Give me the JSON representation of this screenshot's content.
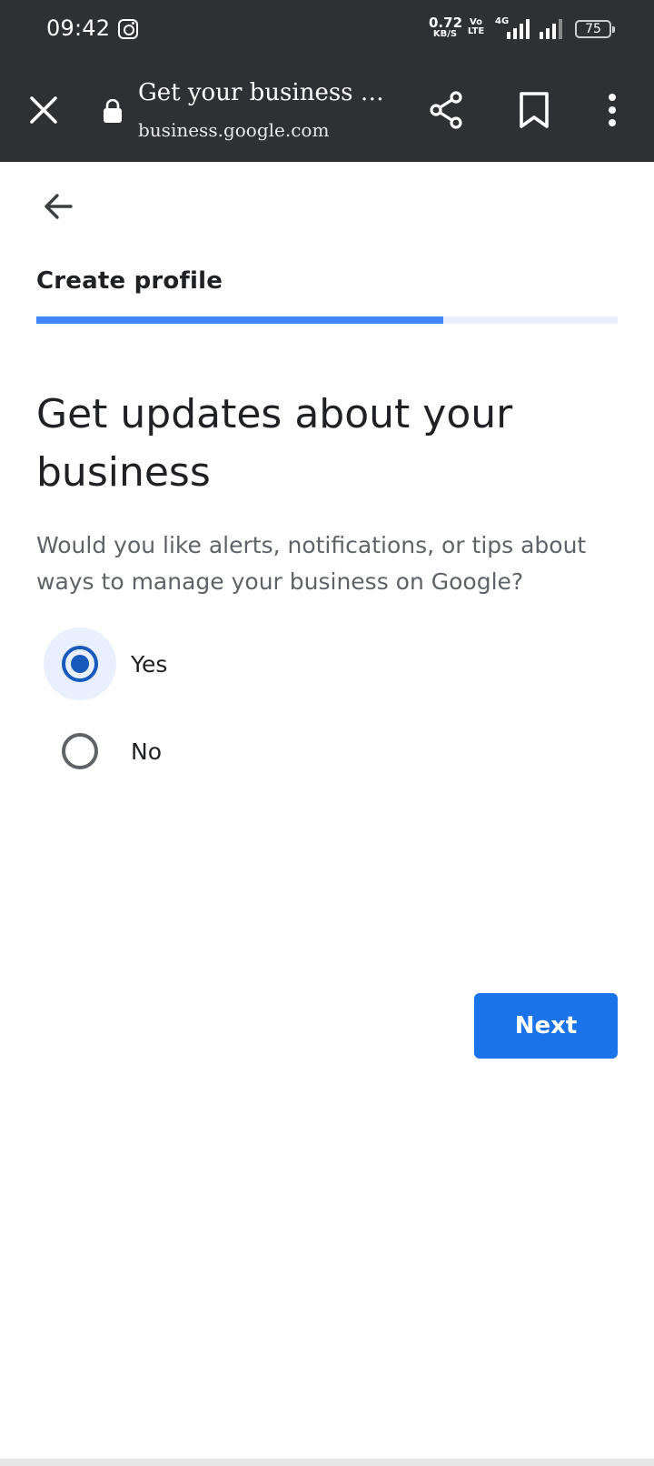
{
  "status_bar": {
    "time": "09:42",
    "speed_value": "0.72",
    "speed_unit": "KB/S",
    "volte_top": "Vo",
    "volte_bottom": "LTE",
    "network": "4G",
    "battery": "75"
  },
  "browser": {
    "page_title": "Get your business …",
    "url": "business.google.com"
  },
  "page": {
    "step_title": "Create profile",
    "progress_fraction": 0.7,
    "heading": "Get updates about your business",
    "description": "Would you like alerts, notifications, or tips about ways to manage your business on Google?",
    "options": [
      {
        "label": "Yes",
        "selected": true
      },
      {
        "label": "No",
        "selected": false
      }
    ],
    "next_label": "Next"
  },
  "colors": {
    "accent": "#1a73e8",
    "progress": "#4285f4",
    "radio_selected": "#185abc",
    "toolbar": "#2f3033"
  }
}
